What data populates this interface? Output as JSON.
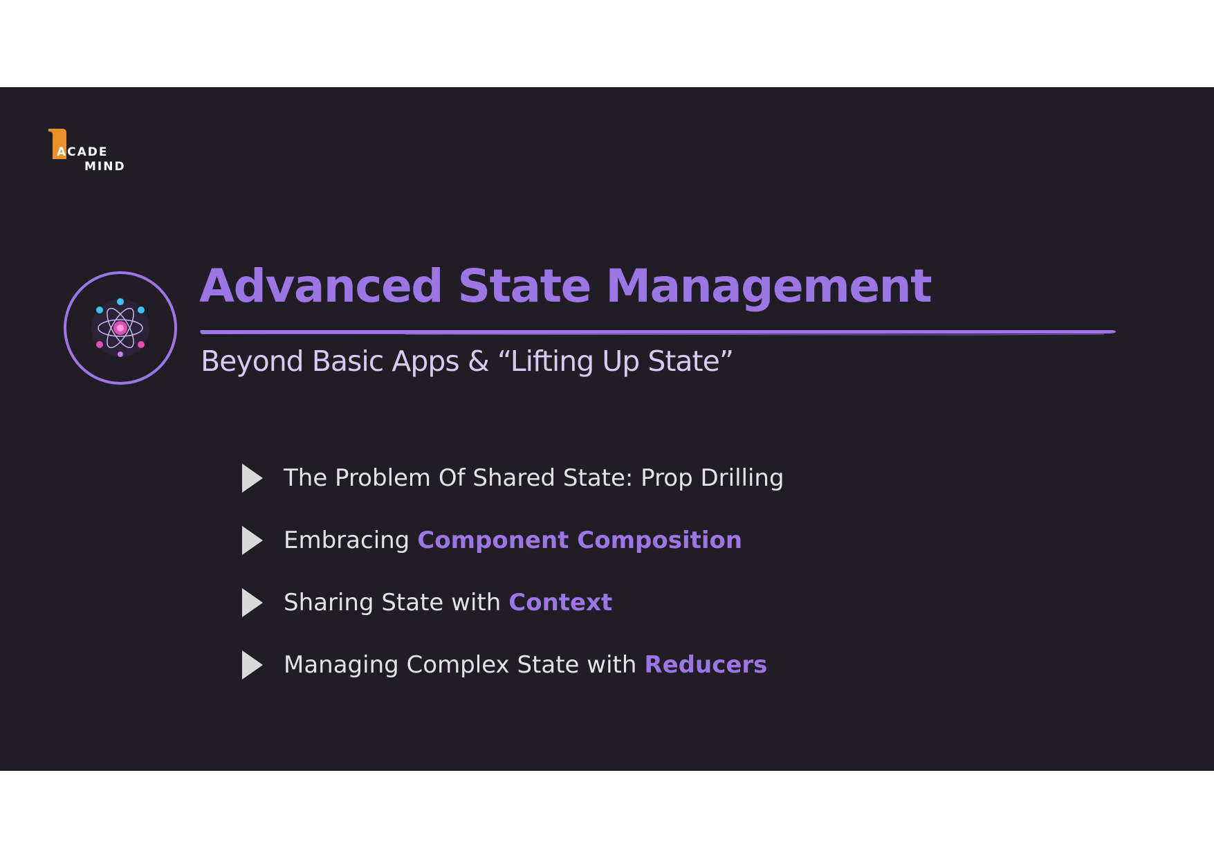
{
  "logo": {
    "line1": "ACADE",
    "line2": "MIND",
    "accent_color": "#e8902a"
  },
  "badge": {
    "icon": "atom-icon"
  },
  "title": "Advanced State Management",
  "subtitle": "Beyond Basic Apps & “Lifting Up State”",
  "colors": {
    "background": "#201e24",
    "accent": "#9d76e6",
    "text": "#e4e4e6",
    "subtitle": "#d8cbf3"
  },
  "bullets": [
    {
      "text": "The Problem Of Shared State: Prop Drilling",
      "highlight": ""
    },
    {
      "text": "Embracing",
      "highlight": "Component Composition"
    },
    {
      "text": "Sharing State with",
      "highlight": "Context"
    },
    {
      "text": "Managing Complex State with",
      "highlight": "Reducers"
    }
  ]
}
